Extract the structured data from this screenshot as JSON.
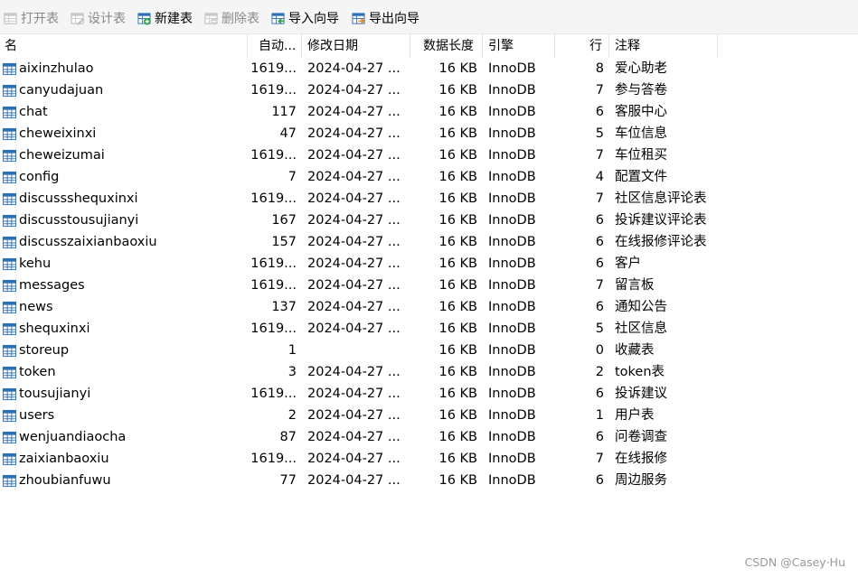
{
  "toolbar": {
    "open_table": "打开表",
    "design_table": "设计表",
    "new_table": "新建表",
    "delete_table": "删除表",
    "import_wizard": "导入向导",
    "export_wizard": "导出向导"
  },
  "columns": {
    "name": "名",
    "auto_increment": "自动...",
    "modified_date": "修改日期",
    "data_length": "数据长度",
    "engine": "引擎",
    "rows": "行",
    "comment": "注释"
  },
  "tables": [
    {
      "name": "aixinzhulao",
      "auto": "1619...",
      "date": "2024-04-27 ...",
      "size": "16 KB",
      "engine": "InnoDB",
      "rows": "8",
      "comment": "爱心助老"
    },
    {
      "name": "canyudajuan",
      "auto": "1619...",
      "date": "2024-04-27 ...",
      "size": "16 KB",
      "engine": "InnoDB",
      "rows": "7",
      "comment": "参与答卷"
    },
    {
      "name": "chat",
      "auto": "117",
      "date": "2024-04-27 ...",
      "size": "16 KB",
      "engine": "InnoDB",
      "rows": "6",
      "comment": "客服中心"
    },
    {
      "name": "cheweixinxi",
      "auto": "47",
      "date": "2024-04-27 ...",
      "size": "16 KB",
      "engine": "InnoDB",
      "rows": "5",
      "comment": "车位信息"
    },
    {
      "name": "cheweizumai",
      "auto": "1619...",
      "date": "2024-04-27 ...",
      "size": "16 KB",
      "engine": "InnoDB",
      "rows": "7",
      "comment": "车位租买"
    },
    {
      "name": "config",
      "auto": "7",
      "date": "2024-04-27 ...",
      "size": "16 KB",
      "engine": "InnoDB",
      "rows": "4",
      "comment": "配置文件"
    },
    {
      "name": "discussshequxinxi",
      "auto": "1619...",
      "date": "2024-04-27 ...",
      "size": "16 KB",
      "engine": "InnoDB",
      "rows": "7",
      "comment": "社区信息评论表"
    },
    {
      "name": "discusstousujianyi",
      "auto": "167",
      "date": "2024-04-27 ...",
      "size": "16 KB",
      "engine": "InnoDB",
      "rows": "6",
      "comment": "投诉建议评论表"
    },
    {
      "name": "discusszaixianbaoxiu",
      "auto": "157",
      "date": "2024-04-27 ...",
      "size": "16 KB",
      "engine": "InnoDB",
      "rows": "6",
      "comment": "在线报修评论表"
    },
    {
      "name": "kehu",
      "auto": "1619...",
      "date": "2024-04-27 ...",
      "size": "16 KB",
      "engine": "InnoDB",
      "rows": "6",
      "comment": "客户"
    },
    {
      "name": "messages",
      "auto": "1619...",
      "date": "2024-04-27 ...",
      "size": "16 KB",
      "engine": "InnoDB",
      "rows": "7",
      "comment": "留言板"
    },
    {
      "name": "news",
      "auto": "137",
      "date": "2024-04-27 ...",
      "size": "16 KB",
      "engine": "InnoDB",
      "rows": "6",
      "comment": "通知公告"
    },
    {
      "name": "shequxinxi",
      "auto": "1619...",
      "date": "2024-04-27 ...",
      "size": "16 KB",
      "engine": "InnoDB",
      "rows": "5",
      "comment": "社区信息"
    },
    {
      "name": "storeup",
      "auto": "1",
      "date": "",
      "size": "16 KB",
      "engine": "InnoDB",
      "rows": "0",
      "comment": "收藏表"
    },
    {
      "name": "token",
      "auto": "3",
      "date": "2024-04-27 ...",
      "size": "16 KB",
      "engine": "InnoDB",
      "rows": "2",
      "comment": "token表"
    },
    {
      "name": "tousujianyi",
      "auto": "1619...",
      "date": "2024-04-27 ...",
      "size": "16 KB",
      "engine": "InnoDB",
      "rows": "6",
      "comment": "投诉建议"
    },
    {
      "name": "users",
      "auto": "2",
      "date": "2024-04-27 ...",
      "size": "16 KB",
      "engine": "InnoDB",
      "rows": "1",
      "comment": "用户表"
    },
    {
      "name": "wenjuandiaocha",
      "auto": "87",
      "date": "2024-04-27 ...",
      "size": "16 KB",
      "engine": "InnoDB",
      "rows": "6",
      "comment": "问卷调查"
    },
    {
      "name": "zaixianbaoxiu",
      "auto": "1619...",
      "date": "2024-04-27 ...",
      "size": "16 KB",
      "engine": "InnoDB",
      "rows": "7",
      "comment": "在线报修"
    },
    {
      "name": "zhoubianfuwu",
      "auto": "77",
      "date": "2024-04-27 ...",
      "size": "16 KB",
      "engine": "InnoDB",
      "rows": "6",
      "comment": "周边服务"
    }
  ],
  "watermark": "CSDN @Casey·Hu",
  "colors": {
    "table_icon": "#2f6fb8",
    "new_icon_green": "#2ea043",
    "disabled_text": "#8a8a8a"
  }
}
